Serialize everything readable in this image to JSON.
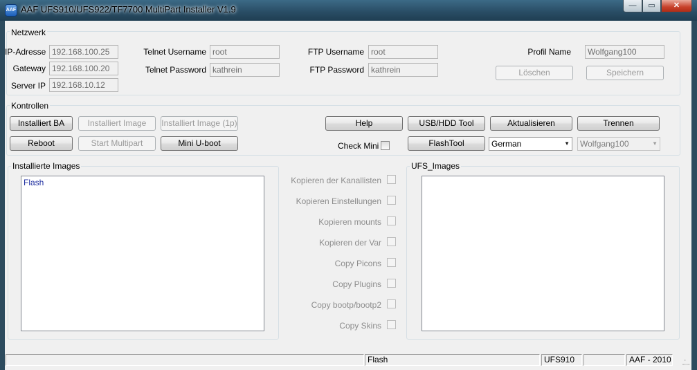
{
  "window": {
    "title": "AAF UFS910/UFS922/TF7700 MultiPart Installer V1.9",
    "icon_text": "AAF",
    "minimize_glyph": "—",
    "maximize_glyph": "▭",
    "close_glyph": "✕"
  },
  "network": {
    "group_label": "Netzwerk",
    "ip_label": "IP-Adresse",
    "ip_value": "192.168.100.25",
    "gateway_label": "Gateway",
    "gateway_value": "192.168.100.20",
    "server_ip_label": "Server IP",
    "server_ip_value": "192.168.10.12",
    "telnet_user_label": "Telnet Username",
    "telnet_user_value": "root",
    "telnet_pass_label": "Telnet Password",
    "telnet_pass_value": "kathrein",
    "ftp_user_label": "FTP Username",
    "ftp_user_value": "root",
    "ftp_pass_label": "FTP Password",
    "ftp_pass_value": "kathrein",
    "profile_label": "Profil Name",
    "profile_value": "Wolfgang100",
    "delete_label": "Löschen",
    "save_label": "Speichern"
  },
  "controls": {
    "group_label": "Kontrollen",
    "install_ba": "Installiert BA",
    "install_image": "Installiert Image",
    "install_image_1p": "Installiert Image (1p)",
    "reboot": "Reboot",
    "start_multipart": "Start Multipart",
    "mini_uboot": "Mini U-boot",
    "help": "Help",
    "usb_hdd_tool": "USB/HDD Tool",
    "update": "Aktualisieren",
    "disconnect": "Trennen",
    "check_mini_label": "Check Mini",
    "flashtool": "FlashTool",
    "language_selected": "German",
    "profile_selected": "Wolfgang100"
  },
  "installed_images": {
    "group_label": "Installierte Images",
    "items": [
      "Flash"
    ]
  },
  "copy_options": [
    {
      "label": "Kopieren der Kanallisten"
    },
    {
      "label": "Kopieren   Einstellungen"
    },
    {
      "label": "Kopieren mounts"
    },
    {
      "label": "Kopieren   der   Var"
    },
    {
      "label": "Copy Picons"
    },
    {
      "label": "Copy Plugins"
    },
    {
      "label": "Copy bootp/bootp2"
    },
    {
      "label": "Copy Skins"
    }
  ],
  "ufs_images": {
    "group_label": "UFS_Images",
    "items": []
  },
  "statusbar": {
    "panel1": "",
    "panel2": "Flash",
    "panel3": "UFS910",
    "panel4": "",
    "panel5": "AAF - 2010"
  }
}
